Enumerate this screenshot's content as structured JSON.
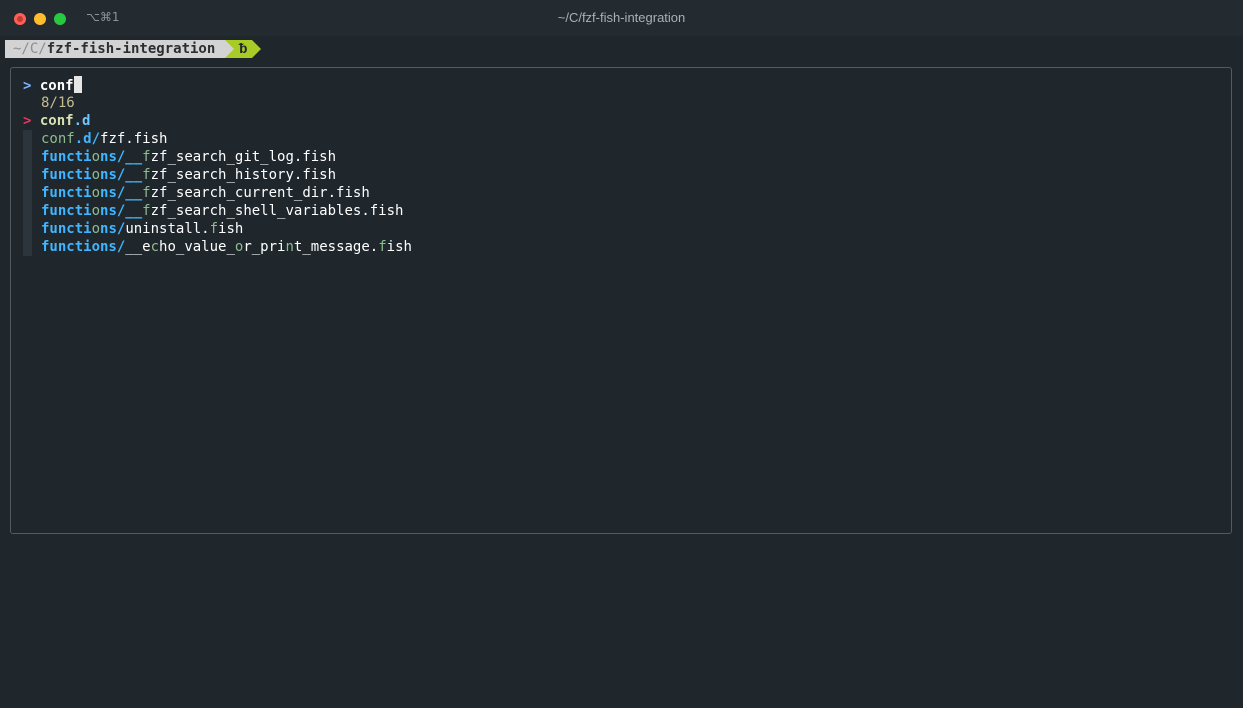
{
  "window": {
    "shortcut": "⌥⌘1",
    "title": "~/C/fzf-fish-integration"
  },
  "prompt": {
    "path_dim": "~/C/",
    "path_bold": "fzf-fish-integration",
    "git_icon": ""
  },
  "fzf": {
    "pointer": ">",
    "query": "conf",
    "count": "8/16",
    "selected_pointer": ">",
    "results": [
      {
        "a": "conf",
        "b": ".d",
        "c": "",
        "d": "",
        "e": "",
        "f": "",
        "g": ""
      },
      {
        "a": "conf",
        "b": ".d/",
        "c": "fzf.fish",
        "d": "",
        "e": "",
        "f": "",
        "g": ""
      },
      {
        "a": "functi",
        "b": "o",
        "c": "n",
        "d": "s/__",
        "e": "f",
        "f": "zf_search_git_log.fish",
        "g": ""
      },
      {
        "a": "functi",
        "b": "o",
        "c": "n",
        "d": "s/__",
        "e": "f",
        "f": "zf_search_history.fish",
        "g": ""
      },
      {
        "a": "functi",
        "b": "o",
        "c": "n",
        "d": "s/__",
        "e": "f",
        "f": "zf_search_current_dir.fish",
        "g": ""
      },
      {
        "a": "functi",
        "b": "o",
        "c": "n",
        "d": "s/__",
        "e": "f",
        "f": "zf_search_shell_variables.fish",
        "g": ""
      },
      {
        "a": "functi",
        "b": "o",
        "c": "n",
        "d": "s/",
        "e": "uninstall.",
        "f": "f",
        "g": "ish"
      },
      {
        "a": "functions/",
        "b": "__e",
        "c": "c",
        "d": "ho_value_",
        "e": "o",
        "f": "r_pri",
        "g": "n"
      }
    ],
    "last_tail": "t_message.",
    "last_f": "f",
    "last_end": "ish"
  }
}
